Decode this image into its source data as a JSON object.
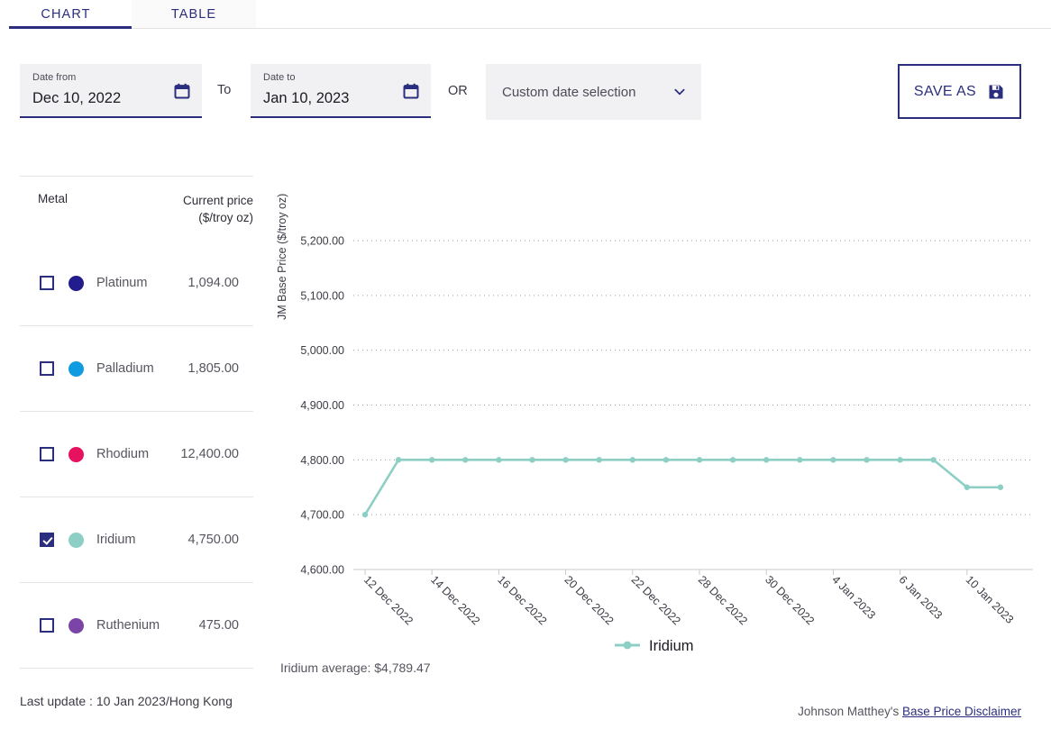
{
  "tabs": [
    {
      "label": "CHART",
      "active": true
    },
    {
      "label": "TABLE",
      "active": false
    }
  ],
  "filters": {
    "date_from": {
      "label": "Date from",
      "value": "Dec 10, 2022",
      "icon": "calendar-icon"
    },
    "to_text": "To",
    "date_to": {
      "label": "Date to",
      "value": "Jan 10, 2023",
      "icon": "calendar-icon"
    },
    "or_text": "OR",
    "custom_select": {
      "value": "Custom date selection",
      "icon": "chevron-down-icon"
    },
    "save_as": {
      "label": "SAVE AS",
      "icon": "floppy-disk-icon"
    }
  },
  "metal_table": {
    "headers": {
      "metal": "Metal",
      "price_line1": "Current price",
      "price_line2": "($/troy oz)"
    },
    "rows": [
      {
        "name": "Platinum",
        "price": "1,094.00",
        "color": "#221C8C",
        "checked": false
      },
      {
        "name": "Palladium",
        "price": "1,805.00",
        "color": "#0F9BE0",
        "checked": false
      },
      {
        "name": "Rhodium",
        "price": "12,400.00",
        "color": "#E6115F",
        "checked": false
      },
      {
        "name": "Iridium",
        "price": "4,750.00",
        "color": "#8DCFC4",
        "checked": true
      },
      {
        "name": "Ruthenium",
        "price": "475.00",
        "color": "#7B45A8",
        "checked": false
      }
    ]
  },
  "footer": {
    "last_update": "Last update : 10 Jan 2023/Hong Kong",
    "disclaimer_prefix": "Johnson Matthey's ",
    "disclaimer_link": "Base Price Disclaimer"
  },
  "average_text": "Iridium average: $4,789.47",
  "chart_data": {
    "type": "line",
    "title": "",
    "xlabel": "",
    "ylabel": "JM Base Price ($/troy oz)",
    "ylim": [
      4600,
      5200
    ],
    "yticks": [
      4600,
      4700,
      4800,
      4900,
      5000,
      5100,
      5200
    ],
    "ytick_labels": [
      "4,600.00",
      "4,700.00",
      "4,800.00",
      "4,900.00",
      "5,000.00",
      "5,100.00",
      "5,200.00"
    ],
    "grid": true,
    "legend": {
      "position": "bottom",
      "entries": [
        "Iridium"
      ]
    },
    "x_tick_labels": [
      "12 Dec 2022",
      "14 Dec 2022",
      "16 Dec 2022",
      "20 Dec 2022",
      "22 Dec 2022",
      "28 Dec 2022",
      "30 Dec 2022",
      "4 Jan 2023",
      "6 Jan 2023",
      "10 Jan 2023"
    ],
    "x_tick_indices": [
      0,
      2,
      4,
      6,
      8,
      10,
      12,
      14,
      16,
      18
    ],
    "series": [
      {
        "name": "Iridium",
        "color": "#8DCFC4",
        "values": [
          4700,
          4800,
          4800,
          4800,
          4800,
          4800,
          4800,
          4800,
          4800,
          4800,
          4800,
          4800,
          4800,
          4800,
          4800,
          4800,
          4800,
          4800,
          4750,
          4750
        ]
      }
    ]
  }
}
